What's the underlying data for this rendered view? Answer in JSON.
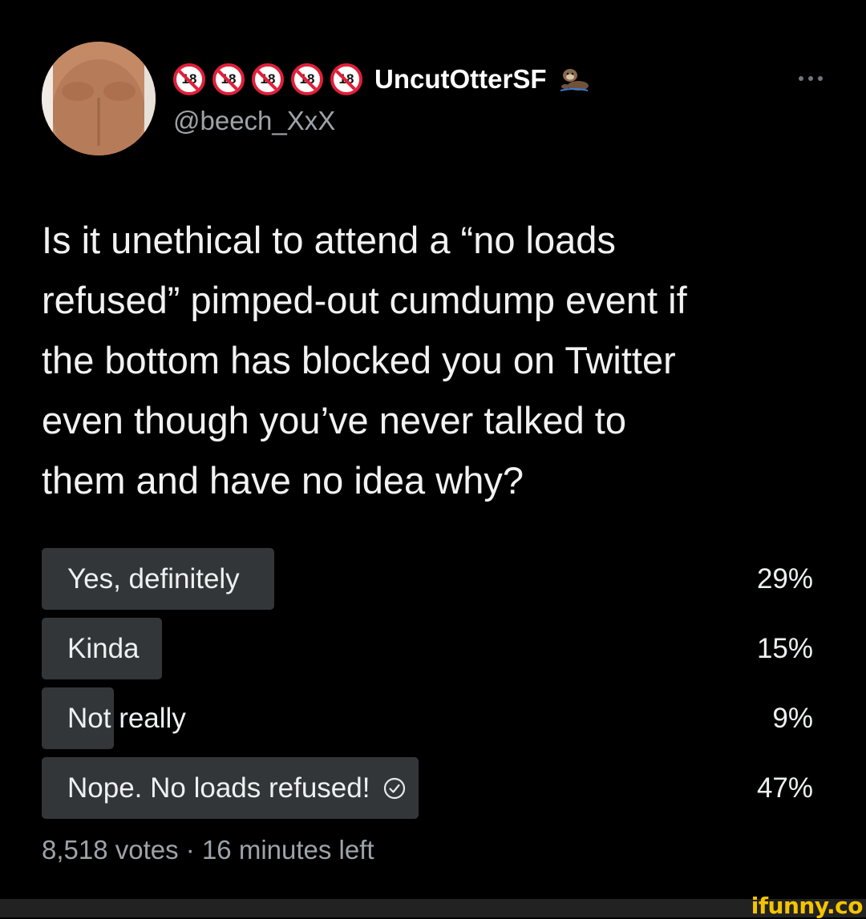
{
  "author": {
    "badges": [
      "18",
      "18",
      "18",
      "18",
      "18"
    ],
    "display_name": "UncutOtterSF",
    "handle": "@beech_XxX",
    "badge_icon": "no-under-18-icon",
    "emoji_icon": "otter-icon",
    "more_icon": "more-icon"
  },
  "tweet": {
    "text": "Is it unethical to attend a “no loads\nrefused” pimped-out cumdump event if\nthe bottom has blocked you on Twitter\neven though you’ve never talked to\nthem and have no idea why?"
  },
  "poll": {
    "options": [
      {
        "label": "Yes, definitely",
        "percent_text": "29%",
        "fraction": 0.29
      },
      {
        "label": "Kinda",
        "percent_text": "15%",
        "fraction": 0.15
      },
      {
        "label": "Not really",
        "percent_text": "9%",
        "fraction": 0.09
      },
      {
        "label": "Nope. No loads refused!",
        "percent_text": "47%",
        "fraction": 0.47,
        "selected_icon": "check-circle-icon"
      }
    ],
    "meta": "8,518 votes · 16 minutes left"
  },
  "watermark": "ifunny.co",
  "colors": {
    "background": "#000000",
    "poll_bar": "#333639",
    "secondary_text": "#9ea3a8",
    "watermark": "#f5c400",
    "badge_red": "#e0203b"
  }
}
